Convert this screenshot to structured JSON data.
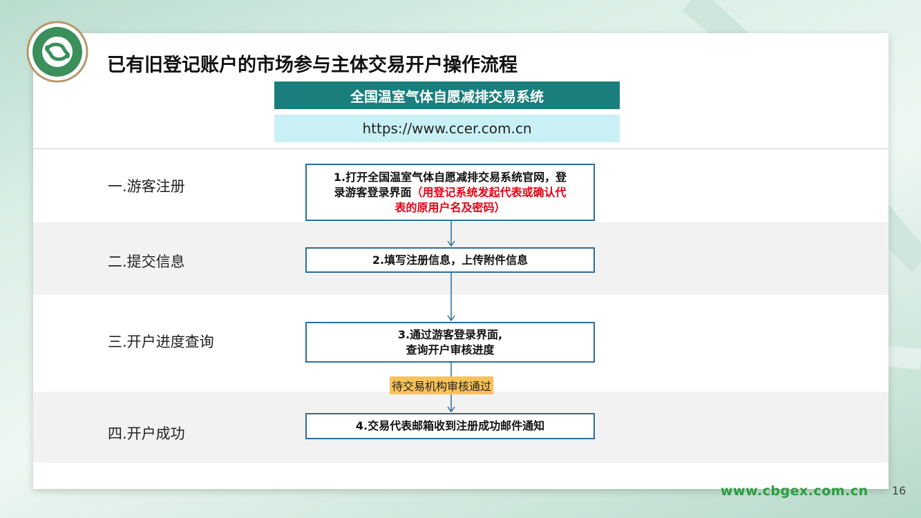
{
  "title": "已有旧登记账户的市场参与主体交易开户操作流程",
  "system": {
    "name": "全国温室气体自愿减排交易系统",
    "url": "https://www.ccer.com.cn"
  },
  "stages": [
    {
      "label": "一.游客注册"
    },
    {
      "label": "二.提交信息"
    },
    {
      "label": "三.开户进度查询"
    },
    {
      "label": "四.开户成功"
    }
  ],
  "steps": {
    "s1_line1": "1.打开全国温室气体自愿减排交易系统官网，登",
    "s1_line2": "录游客登录界面",
    "s1_red_a": "（用登记系统发起代表或确认代",
    "s1_red_b": "表的原用户名及密码）",
    "s2": "2.填写注册信息，上传附件信息",
    "s3_line1": "3.通过游客登录界面,",
    "s3_line2": "查询开户审核进度",
    "s4": "4.交易代表邮箱收到注册成功邮件通知"
  },
  "note": "待交易机构审核通过",
  "footer": {
    "url": "www.cbgex.com.cn",
    "page": "16"
  },
  "colors": {
    "system_name_bg": "#1a7e7c",
    "system_url_bg": "#c9f1f5",
    "step_border": "#2a6d9d",
    "highlight_red": "#e60012",
    "note_bg": "#f7c25a",
    "footer_green": "#2a9d3c"
  }
}
